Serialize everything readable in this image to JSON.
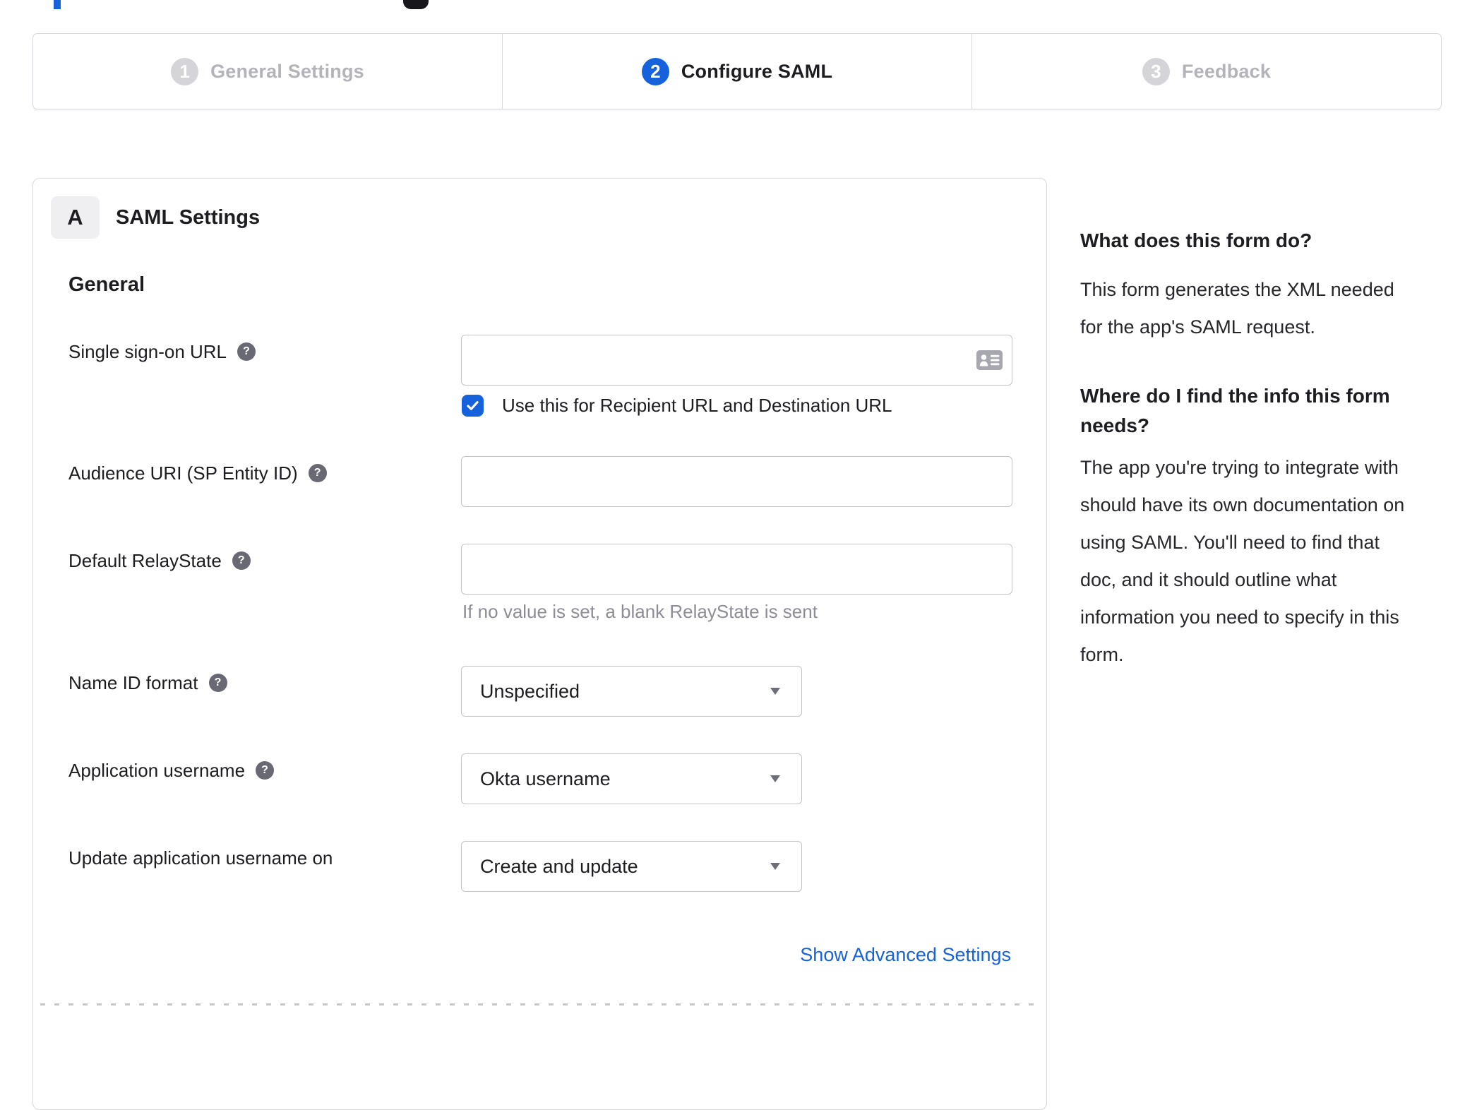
{
  "colors": {
    "accent_blue": "#1662dd",
    "text_dark": "#1d1d21",
    "inactive_gray": "#b3b3ba",
    "step_circle_gray": "#d4d4d9",
    "border_gray": "#d8d8dd",
    "input_border": "#c3c3c9",
    "hint_gray": "#8d8d96",
    "help_icon_gray": "#696973"
  },
  "stepper": {
    "steps": [
      {
        "number": "1",
        "label": "General Settings",
        "state": "complete"
      },
      {
        "number": "2",
        "label": "Configure SAML",
        "state": "active"
      },
      {
        "number": "3",
        "label": "Feedback",
        "state": "upcoming"
      }
    ]
  },
  "panel": {
    "section_badge": "A",
    "section_title": "SAML Settings",
    "subsection_title": "General",
    "fields": {
      "sso_url": {
        "label": "Single sign-on URL",
        "value": "",
        "has_help": true,
        "trailing_icon": "contact-card-icon",
        "checkbox_label": "Use this for Recipient URL and Destination URL",
        "checkbox_checked": true
      },
      "audience_uri": {
        "label": "Audience URI (SP Entity ID)",
        "value": "",
        "has_help": true
      },
      "default_relaystate": {
        "label": "Default RelayState",
        "value": "",
        "has_help": true,
        "hint": "If no value is set, a blank RelayState is sent"
      },
      "name_id_format": {
        "label": "Name ID format",
        "has_help": true,
        "selected_value": "Unspecified"
      },
      "application_username": {
        "label": "Application username",
        "has_help": true,
        "selected_value": "Okta username"
      },
      "update_application_username_on": {
        "label": "Update application username on",
        "has_help": false,
        "selected_value": "Create and update"
      }
    },
    "advanced_link_label": "Show Advanced Settings"
  },
  "sidebar": {
    "section1": {
      "heading": "What does this form do?",
      "body_lines": [
        "This form generates the XML needed",
        "for the app's SAML request."
      ]
    },
    "section2": {
      "heading_lines": [
        "Where do I find the info this form",
        "needs?"
      ],
      "body_lines": [
        "The app you're trying to integrate with",
        "should have its own documentation on",
        "using SAML. You'll need to find that",
        "doc, and it should outline what",
        "information you need to specify in this",
        "form."
      ]
    }
  }
}
